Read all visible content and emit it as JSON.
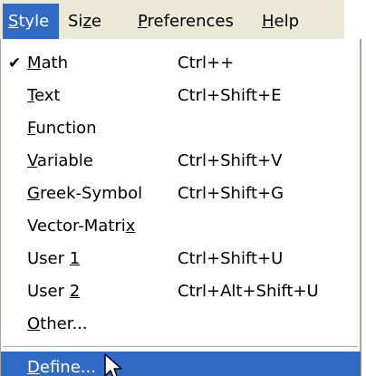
{
  "menubar": {
    "items": [
      {
        "pre": "",
        "acc": "S",
        "post": "tyle",
        "active": true
      },
      {
        "pre": "Si",
        "acc": "z",
        "post": "e",
        "active": false
      },
      {
        "pre": "",
        "acc": "P",
        "post": "references",
        "active": false
      },
      {
        "pre": "",
        "acc": "H",
        "post": "elp",
        "active": false
      }
    ]
  },
  "style_menu": {
    "items": [
      {
        "pre": "",
        "acc": "M",
        "post": "ath",
        "shortcut": "Ctrl++",
        "checked": true,
        "check_glyph": "✔"
      },
      {
        "pre": "",
        "acc": "T",
        "post": "ext",
        "shortcut": "Ctrl+Shift+E",
        "checked": false
      },
      {
        "pre": "",
        "acc": "F",
        "post": "unction",
        "shortcut": "",
        "checked": false
      },
      {
        "pre": "",
        "acc": "V",
        "post": "ariable",
        "shortcut": "Ctrl+Shift+V",
        "checked": false
      },
      {
        "pre": "",
        "acc": "G",
        "post": "reek-Symbol",
        "shortcut": "Ctrl+Shift+G",
        "checked": false
      },
      {
        "pre": "Vector-Matri",
        "acc": "x",
        "post": "",
        "shortcut": "",
        "checked": false
      },
      {
        "pre": "User ",
        "acc": "1",
        "post": "",
        "shortcut": "Ctrl+Shift+U",
        "checked": false
      },
      {
        "pre": "User ",
        "acc": "2",
        "post": "",
        "shortcut": "Ctrl+Alt+Shift+U",
        "checked": false
      },
      {
        "pre": "",
        "acc": "O",
        "post": "ther...",
        "shortcut": "",
        "checked": false
      },
      {
        "pre": "",
        "acc": "D",
        "post": "efine...",
        "shortcut": "",
        "checked": false,
        "highlighted": true
      }
    ]
  },
  "colors": {
    "highlight": "#316ac5",
    "menubar_bg": "#ece9d8",
    "border": "#aca899"
  },
  "icons": {
    "check": "checkmark-icon",
    "cursor": "mouse-pointer-icon"
  }
}
